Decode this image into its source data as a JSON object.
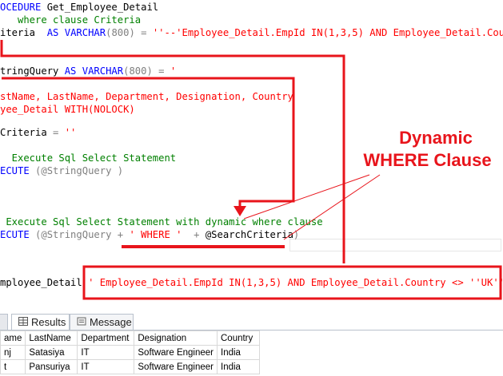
{
  "code": {
    "l1": [
      "OCEDURE",
      " Get_Employee_Detail"
    ],
    "l2": "   where clause Criteria",
    "l3": [
      "iteria  ",
      "AS",
      " ",
      "VARCHAR",
      "(800) = ",
      "''--'Employee_Detail.EmpId IN(1,3,5) AND Employee_Detail.Country <> ''"
    ],
    "l5": [
      "tringQuery ",
      "AS",
      " ",
      "VARCHAR",
      "(800) = ",
      "'"
    ],
    "l7": "stName, LastName, Department, Designation, Country",
    "l8": "yee_Detail WITH(NOLOCK)",
    "l10": [
      "Criteria",
      " = ",
      "''"
    ],
    "l12": "  Execute Sql Select Statement",
    "l13": [
      "ECUTE ",
      "(@StringQuery )"
    ],
    "l17": " Execute Sql Select Statement with dynamic where clause",
    "l18": [
      "ECUTE ",
      "(@StringQuery + ",
      "' WHERE '",
      "  + ",
      "@SearchCriteria",
      ")"
    ],
    "l22": [
      "mployee_Detail ",
      "' Employee_Detail.EmpId IN(1,3,5) AND Employee_Detail.Country <> ''UK'''"
    ]
  },
  "annotation": {
    "line1": "Dynamic",
    "line2": "WHERE Clause",
    "color": "#e8141b"
  },
  "tabs": {
    "results_label": "Results",
    "message_label": "Message"
  },
  "results": {
    "headers": [
      "ame",
      "LastName",
      "Department",
      "Designation",
      "Country"
    ],
    "rows": [
      [
        "nj",
        "Satasiya",
        "IT",
        "Software Engineer",
        "India"
      ],
      [
        "t",
        "Pansuriya",
        "IT",
        "Software Engineer",
        "India"
      ]
    ]
  }
}
